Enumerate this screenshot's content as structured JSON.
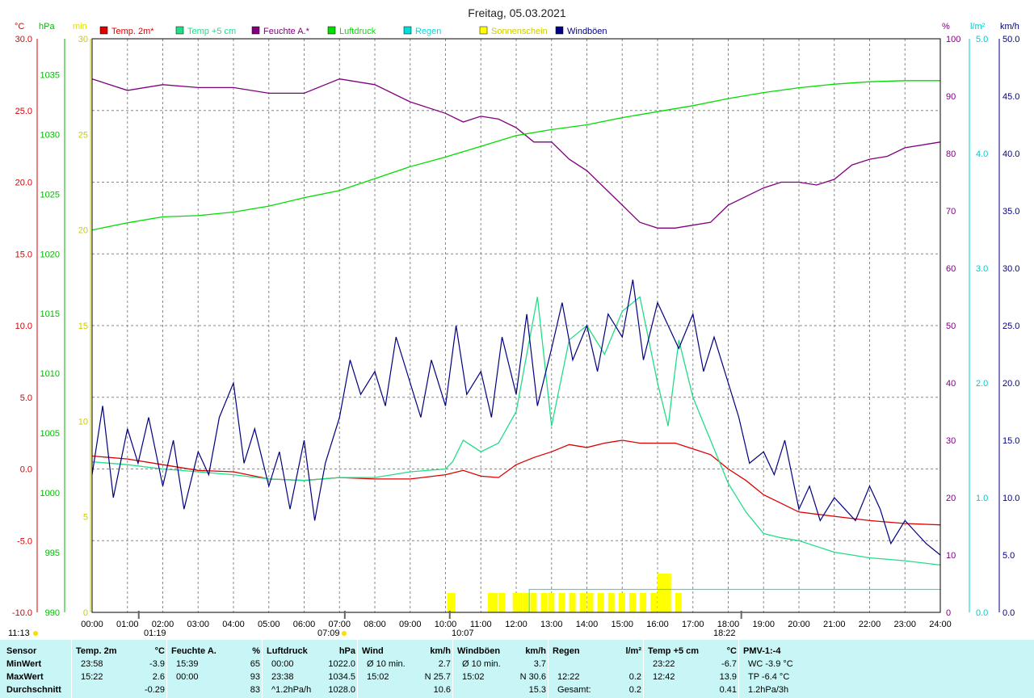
{
  "title": "Freitag, 05.03.2021",
  "colors": {
    "temp2m": "#dd0000",
    "temp5cm": "#22dd88",
    "humidity": "#800080",
    "pressure": "#00dd00",
    "rain": "#00dddd",
    "sun": "#ffff00",
    "gust": "#000080",
    "grid": "#808080"
  },
  "axis_headers": {
    "temp_unit": "°C",
    "pressure_unit": "hPa",
    "sun_unit": "min",
    "humidity_unit": "%",
    "rain_unit": "l/m²",
    "wind_unit": "km/h"
  },
  "legend": [
    {
      "label": "Temp. 2m*",
      "color": "#dd0000"
    },
    {
      "label": "Temp +5 cm",
      "color": "#22dd88"
    },
    {
      "label": "Feuchte A.*",
      "color": "#800080"
    },
    {
      "label": "Luftdruck",
      "color": "#00dd00"
    },
    {
      "label": "Regen",
      "color": "#00dddd"
    },
    {
      "label": "Sonnenschein",
      "color": "#ffff00"
    },
    {
      "label": "Windböen",
      "color": "#000080"
    }
  ],
  "markers": {
    "left_time": "11:13",
    "moon_rise": "01:19",
    "sun_rise": "07:09",
    "moon_set": "10:07",
    "sun_set": "18:22"
  },
  "chart_data": {
    "type": "line",
    "x_ticks": [
      "00:00",
      "01:00",
      "02:00",
      "03:00",
      "04:00",
      "05:00",
      "06:00",
      "07:00",
      "08:00",
      "09:00",
      "10:00",
      "11:00",
      "12:00",
      "13:00",
      "14:00",
      "15:00",
      "16:00",
      "17:00",
      "18:00",
      "19:00",
      "20:00",
      "21:00",
      "22:00",
      "23:00",
      "24:00"
    ],
    "axes": {
      "temp": {
        "ticks": [
          "30.0",
          "25.0",
          "20.0",
          "15.0",
          "10.0",
          "5.0",
          "0.0",
          "-5.0",
          "-10.0"
        ],
        "range": [
          -10,
          30
        ]
      },
      "pressure": {
        "ticks": [
          "1035",
          "1030",
          "1025",
          "1020",
          "1015",
          "1010",
          "1005",
          "1000",
          "995",
          "990"
        ],
        "range": [
          990,
          1038
        ]
      },
      "sun": {
        "ticks": [
          "30",
          "25",
          "20",
          "15",
          "10",
          "5",
          "0"
        ],
        "range": [
          0,
          30
        ]
      },
      "humidity": {
        "ticks": [
          "100",
          "90",
          "80",
          "70",
          "60",
          "50",
          "40",
          "30",
          "20",
          "10",
          "0"
        ],
        "range": [
          0,
          100
        ]
      },
      "rain": {
        "ticks": [
          "5.0",
          "4.0",
          "3.0",
          "2.0",
          "1.0",
          "0.0"
        ],
        "range": [
          0,
          5
        ]
      },
      "wind": {
        "ticks": [
          "50.0",
          "45.0",
          "40.0",
          "35.0",
          "30.0",
          "25.0",
          "20.0",
          "15.0",
          "10.0",
          "5.0",
          "0.0"
        ],
        "range": [
          0,
          50
        ]
      }
    },
    "series": [
      {
        "name": "Temp. 2m*",
        "axis": "temp",
        "x": [
          0,
          1,
          2,
          3,
          4,
          5,
          6,
          7,
          8,
          9,
          10,
          10.5,
          11,
          11.5,
          12,
          12.5,
          13,
          13.5,
          14,
          14.5,
          15,
          15.5,
          16,
          16.5,
          17,
          17.5,
          18,
          18.5,
          19,
          19.5,
          20,
          21,
          22,
          23,
          24
        ],
        "y": [
          0.9,
          0.7,
          0.3,
          -0.1,
          -0.2,
          -0.7,
          -0.8,
          -0.6,
          -0.7,
          -0.7,
          -0.4,
          -0.1,
          -0.5,
          -0.6,
          0.3,
          0.8,
          1.2,
          1.7,
          1.5,
          1.8,
          2.0,
          1.8,
          1.8,
          1.8,
          1.4,
          1.0,
          0.0,
          -0.8,
          -1.8,
          -2.4,
          -3.0,
          -3.3,
          -3.6,
          -3.8,
          -3.9
        ]
      },
      {
        "name": "Temp +5 cm",
        "axis": "temp",
        "x": [
          0,
          1,
          2,
          3,
          4,
          5,
          6,
          7,
          8,
          9,
          10,
          10.2,
          10.5,
          11,
          11.5,
          12,
          12.3,
          12.6,
          13,
          13.5,
          14,
          14.5,
          15,
          15.5,
          16,
          16.3,
          16.6,
          17,
          17.5,
          18,
          18.5,
          19,
          19.5,
          20,
          21,
          22,
          23,
          24
        ],
        "y": [
          0.5,
          0.3,
          0.0,
          -0.2,
          -0.4,
          -0.7,
          -0.8,
          -0.6,
          -0.6,
          -0.2,
          0.0,
          0.5,
          2.0,
          1.2,
          1.8,
          4.0,
          8.0,
          12.0,
          3.0,
          9.0,
          10.0,
          8.0,
          11.0,
          12.0,
          6.0,
          3.0,
          9.0,
          5.0,
          2.0,
          -1.0,
          -3.0,
          -4.5,
          -4.8,
          -5.0,
          -5.8,
          -6.2,
          -6.4,
          -6.7
        ]
      },
      {
        "name": "Feuchte A.*",
        "axis": "humidity",
        "x": [
          0,
          1,
          2,
          3,
          4,
          5,
          6,
          7,
          8,
          9,
          10,
          10.5,
          11,
          11.5,
          12,
          12.5,
          13,
          13.5,
          14,
          14.5,
          15,
          15.5,
          16,
          16.5,
          17,
          17.5,
          18,
          19,
          19.5,
          20,
          20.5,
          21,
          21.5,
          22,
          22.5,
          23,
          24
        ],
        "y": [
          93,
          91,
          92,
          91.5,
          91.5,
          90.5,
          90.5,
          93,
          92,
          89,
          87,
          85.5,
          86.5,
          86,
          84.5,
          82,
          82,
          79,
          77,
          74,
          71,
          68,
          67,
          67,
          67.5,
          68,
          71,
          74,
          75,
          75,
          74.5,
          75.5,
          78,
          79,
          79.5,
          81,
          82
        ]
      },
      {
        "name": "Luftdruck",
        "axis": "pressure",
        "x": [
          0,
          1,
          2,
          3,
          4,
          5,
          6,
          7,
          8,
          9,
          10,
          11,
          12,
          13,
          14,
          15,
          16,
          17,
          18,
          19,
          20,
          21,
          22,
          23,
          24
        ],
        "y": [
          1022.0,
          1022.6,
          1023.1,
          1023.2,
          1023.5,
          1024.0,
          1024.7,
          1025.3,
          1026.3,
          1027.3,
          1028.1,
          1029.0,
          1029.9,
          1030.4,
          1030.8,
          1031.4,
          1031.9,
          1032.4,
          1033.0,
          1033.5,
          1033.9,
          1034.2,
          1034.4,
          1034.5,
          1034.5
        ]
      },
      {
        "name": "Windböen",
        "axis": "wind",
        "x": [
          0,
          0.3,
          0.6,
          1.0,
          1.3,
          1.6,
          2.0,
          2.3,
          2.6,
          3.0,
          3.3,
          3.6,
          4.0,
          4.3,
          4.6,
          5.0,
          5.3,
          5.6,
          6.0,
          6.3,
          6.6,
          7.0,
          7.3,
          7.6,
          8.0,
          8.3,
          8.6,
          9.0,
          9.3,
          9.6,
          10.0,
          10.3,
          10.6,
          11.0,
          11.3,
          11.6,
          12.0,
          12.3,
          12.6,
          13.0,
          13.3,
          13.6,
          14.0,
          14.3,
          14.6,
          15.0,
          15.3,
          15.6,
          16.0,
          16.3,
          16.6,
          17.0,
          17.3,
          17.6,
          18.0,
          18.3,
          18.6,
          19.0,
          19.3,
          19.6,
          20.0,
          20.3,
          20.6,
          21.0,
          21.3,
          21.6,
          22.0,
          22.3,
          22.6,
          23.0,
          23.3,
          23.6,
          24.0
        ],
        "y": [
          12,
          18,
          10,
          16,
          13,
          17,
          11,
          15,
          9,
          14,
          12,
          17,
          20,
          13,
          16,
          11,
          14,
          9,
          15,
          8,
          13,
          17,
          22,
          19,
          21,
          18,
          24,
          20,
          17,
          22,
          18,
          25,
          19,
          21,
          17,
          24,
          19,
          26,
          18,
          23,
          27,
          22,
          25,
          21,
          26,
          24,
          29,
          22,
          27,
          25,
          23,
          26,
          21,
          24,
          20,
          17,
          13,
          14,
          12,
          15,
          9,
          11,
          8,
          10,
          9,
          8,
          11,
          9,
          6,
          8,
          7,
          6,
          5
        ]
      }
    ],
    "sunshine_hours": [
      10.05,
      10.1,
      11.2,
      11.3,
      11.5,
      11.9,
      12.0,
      12.2,
      12.4,
      12.7,
      12.9,
      13.2,
      13.5,
      13.8,
      14.0,
      14.3,
      14.6,
      14.9,
      15.2,
      15.5,
      15.8,
      16.0,
      16.1,
      16.2,
      16.5
    ],
    "rain_total_level": 0.2,
    "grid": true
  },
  "stats": {
    "headers": [
      {
        "label": "Sensor",
        "unit": ""
      },
      {
        "label": "Temp. 2m",
        "unit": "°C"
      },
      {
        "label": "Feuchte A.",
        "unit": "%"
      },
      {
        "label": "Luftdruck",
        "unit": "hPa"
      },
      {
        "label": "Wind",
        "unit": "km/h"
      },
      {
        "label": "Windböen",
        "unit": "km/h"
      },
      {
        "label": "Regen",
        "unit": "l/m²"
      },
      {
        "label": "Temp +5 cm",
        "unit": "°C"
      },
      {
        "label": "PMV-1:-4",
        "unit": ""
      }
    ],
    "rows": [
      {
        "label": "MinWert",
        "cols": [
          [
            "23:58",
            "-3.9"
          ],
          [
            "15:39",
            "65"
          ],
          [
            "00:00",
            "1022.0"
          ],
          [
            "Ø 10 min.",
            "2.7"
          ],
          [
            "Ø 10 min.",
            "3.7"
          ],
          [
            "",
            ""
          ],
          [
            "23:22",
            "-6.7"
          ],
          [
            "WC -3.9 °C",
            ""
          ]
        ]
      },
      {
        "label": "MaxWert",
        "cols": [
          [
            "15:22",
            "2.6"
          ],
          [
            "00:00",
            "93"
          ],
          [
            "23:38",
            "1034.5"
          ],
          [
            "15:02",
            "N 25.7"
          ],
          [
            "15:02",
            "N 30.6"
          ],
          [
            "12:22",
            "0.2"
          ],
          [
            "12:42",
            "13.9"
          ],
          [
            "TP -6.4 °C",
            ""
          ]
        ]
      },
      {
        "label": "Durchschnitt",
        "cols": [
          [
            "",
            "-0.29"
          ],
          [
            "",
            "83"
          ],
          [
            "^1.2hPa/h",
            "1028.0"
          ],
          [
            "",
            "10.6"
          ],
          [
            "",
            "15.3"
          ],
          [
            "Gesamt:",
            "0.2"
          ],
          [
            "",
            "0.41"
          ],
          [
            "1.2hPa/3h",
            ""
          ]
        ]
      }
    ]
  }
}
